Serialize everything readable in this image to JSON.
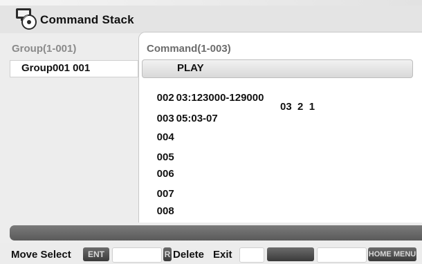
{
  "title": "Command Stack",
  "group_panel": {
    "header": "Group(1-001)",
    "items": [
      "Group001 001"
    ]
  },
  "command_panel": {
    "header": "Command(1-003)",
    "selected": {
      "label": "PLAY"
    },
    "rows": [
      {
        "num": "002",
        "p1": "03:123000-129000",
        "p2": ""
      },
      {
        "num": "003",
        "p1": "05:03-07",
        "p2": "03  2  1"
      },
      {
        "num": "004",
        "p1": "",
        "p2": ""
      },
      {
        "num": "005",
        "p1": "",
        "p2": ""
      },
      {
        "num": "006",
        "p1": "",
        "p2": ""
      },
      {
        "num": "007",
        "p1": "",
        "p2": ""
      },
      {
        "num": "008",
        "p1": "",
        "p2": ""
      }
    ]
  },
  "footer": {
    "move_select": "Move Select",
    "enter_key": "ENT",
    "red_key": "R",
    "delete": "Delete",
    "exit": "Exit",
    "home_menu": "HOME MENU"
  },
  "colors": {
    "background": "#ededed",
    "panel": "#ffffff",
    "status_bar": "#606060"
  }
}
